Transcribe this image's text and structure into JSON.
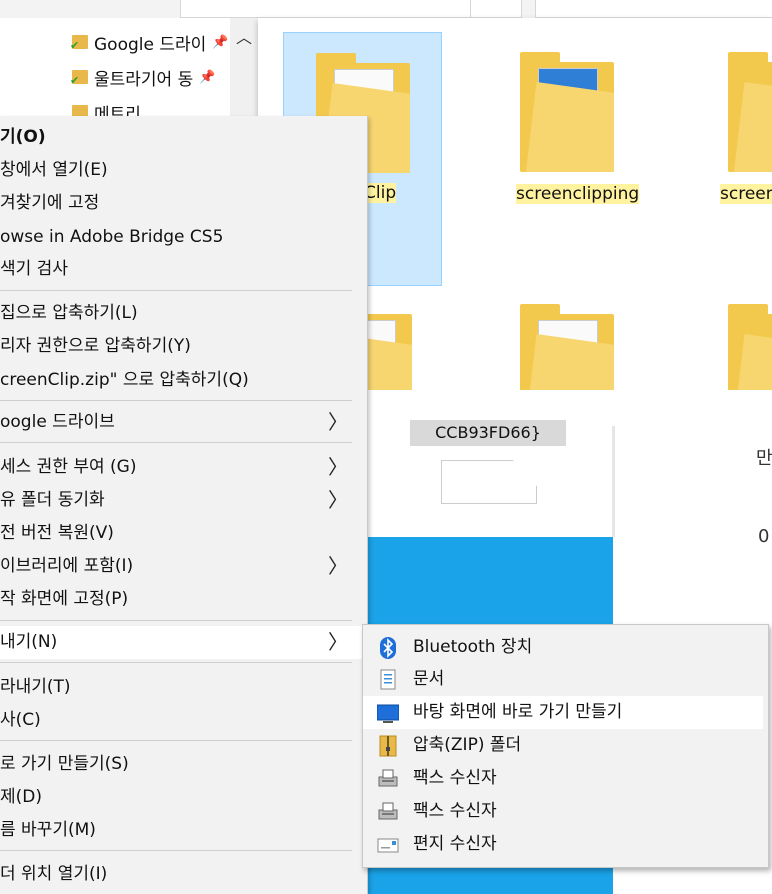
{
  "nav": {
    "items": [
      {
        "label": "Google 드라이",
        "pinned": true
      },
      {
        "label": "울트라기어 동",
        "pinned": true
      },
      {
        "label": "메트리",
        "pinned": false
      }
    ]
  },
  "search_value": "screenclip",
  "folders": [
    {
      "label": "Clip",
      "selected": true
    },
    {
      "label": "screenclipping",
      "selected": false
    },
    {
      "label": "screen",
      "selected": false
    }
  ],
  "bg_guid": "CCB93FD66}",
  "bg_right_glyph_1": "만",
  "bg_right_glyph_2": "0",
  "context_menu": {
    "items": [
      {
        "label": "기(O)",
        "bold": true
      },
      {
        "label": " 창에서 열기(E)"
      },
      {
        "label": "겨찾기에 고정"
      },
      {
        "label": "owse in Adobe Bridge CS5"
      },
      {
        "label": "색기 검사"
      },
      {
        "label": "집으로 압축하기(L)"
      },
      {
        "label": "리자 권한으로 압축하기(Y)"
      },
      {
        "label": "creenClip.zip\" 으로 압축하기(Q)"
      },
      {
        "label": "oogle 드라이브",
        "submenu": true
      },
      {
        "label": "세스 권한 부여 (G)",
        "submenu": true
      },
      {
        "label": "유 폴더 동기화",
        "submenu": true
      },
      {
        "label": "전 버전 복원(V)"
      },
      {
        "label": "이브러리에 포함(I)",
        "submenu": true
      },
      {
        "label": "작 화면에 고정(P)"
      },
      {
        "label": "내기(N)",
        "submenu": true,
        "active": true
      },
      {
        "label": "라내기(T)"
      },
      {
        "label": "사(C)"
      },
      {
        "label": "로 가기 만들기(S)"
      },
      {
        "label": "제(D)"
      },
      {
        "label": "름 바꾸기(M)"
      },
      {
        "label": "더 위치 열기(I)"
      }
    ]
  },
  "send_to_menu": {
    "items": [
      {
        "label": "Bluetooth 장치",
        "icon": "bluetooth-icon"
      },
      {
        "label": "문서",
        "icon": "documents-icon"
      },
      {
        "label": "바탕 화면에 바로 가기 만들기",
        "icon": "desktop-icon",
        "active": true
      },
      {
        "label": "압축(ZIP) 폴더",
        "icon": "zip-folder-icon"
      },
      {
        "label": "팩스 수신자",
        "icon": "fax-icon"
      },
      {
        "label": "팩스 수신자",
        "icon": "fax-icon"
      },
      {
        "label": "편지 수신자",
        "icon": "mail-icon"
      }
    ]
  },
  "colors": {
    "menu_bg": "#f2f2f2",
    "selection": "#cce8ff",
    "highlight": "#fff3a0",
    "accent_blue": "#1aa3e8",
    "bluetooth": "#1e6fd9"
  }
}
